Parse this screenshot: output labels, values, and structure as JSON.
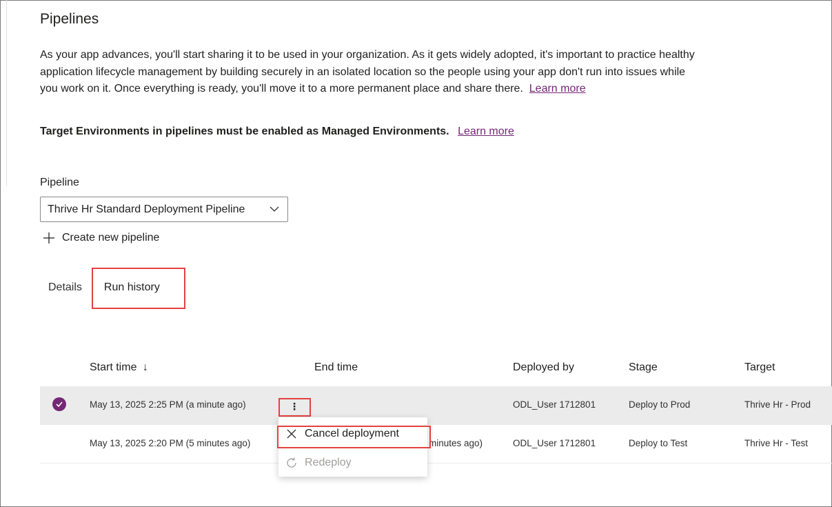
{
  "page": {
    "title": "Pipelines",
    "description": "As your app advances, you'll start sharing it to be used in your organization. As it gets widely adopted, it's important to practice healthy application lifecycle management by building securely in an isolated location so the people using your app don't run into issues while you work on it. Once everything is ready, you'll move it to a more permanent place and share there.",
    "learn_more": "Learn more",
    "managed_note": "Target Environments in pipelines must be enabled as Managed Environments.",
    "managed_learn_more": "Learn more"
  },
  "pipeline": {
    "label": "Pipeline",
    "selected": "Thrive Hr Standard Deployment Pipeline",
    "create_new": "Create new pipeline"
  },
  "tabs": [
    {
      "label": "Details",
      "active": false
    },
    {
      "label": "Run history",
      "active": true
    }
  ],
  "grid": {
    "columns": {
      "start_time": "Start time",
      "sort_arrow": "↓",
      "end_time": "End time",
      "deployed_by": "Deployed by",
      "stage": "Stage",
      "target": "Target"
    },
    "rows": [
      {
        "start_time": "May 13, 2025 2:25 PM (a minute ago)",
        "end_time": "",
        "deployed_by": "ODL_User 1712801",
        "stage": "Deploy to Prod",
        "target": "Thrive Hr - Prod",
        "selected": true,
        "more_label": "⋮"
      },
      {
        "start_time": "May 13, 2025 2:20 PM (5 minutes ago)",
        "end_time": "May 13, 2025 2:21 PM (4 minutes ago)",
        "end_time_visible": "minutes ago)",
        "deployed_by": "ODL_User 1712801",
        "stage": "Deploy to Test",
        "target": "Thrive Hr - Test",
        "selected": false
      }
    ]
  },
  "context_menu": {
    "items": [
      {
        "label": "Cancel deployment",
        "icon": "close-icon",
        "enabled": true
      },
      {
        "label": "Redeploy",
        "icon": "refresh-icon",
        "enabled": false
      }
    ]
  },
  "colors": {
    "accent": "#742774",
    "highlight_box": "#e3403f",
    "selected_row": "#ebebeb"
  }
}
